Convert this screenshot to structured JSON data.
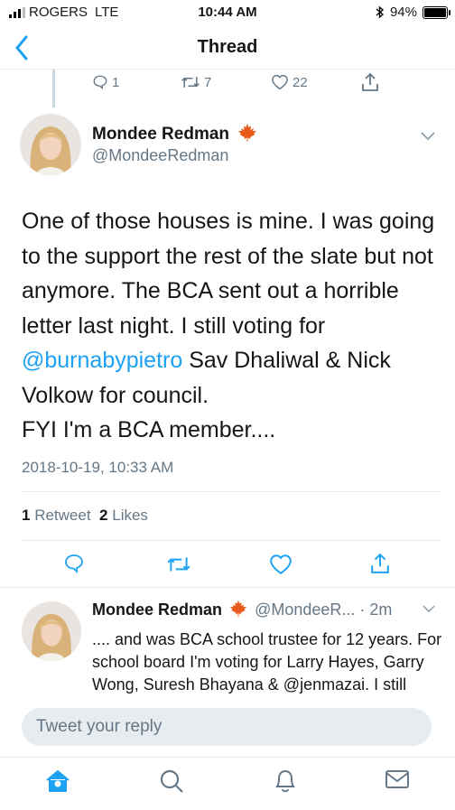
{
  "status_bar": {
    "carrier": "ROGERS",
    "network": "LTE",
    "time": "10:44 AM",
    "battery": "94%"
  },
  "nav": {
    "title": "Thread"
  },
  "prev_tweet_actions": {
    "replies": "1",
    "retweets": "7",
    "likes": "22"
  },
  "main_tweet": {
    "name": "Mondee Redman",
    "handle": "@MondeeRedman",
    "text_before_mention": "One of those houses is mine. I was going to the support the rest of the slate but not anymore. The BCA sent out a horrible letter last night.  I still voting for ",
    "mention": "@burnabypietro",
    "text_after_mention": " Sav Dhaliwal & Nick Volkow for council.",
    "text_line2": "FYI I'm a BCA member....",
    "timestamp": "2018-10-19, 10:33 AM",
    "retweet_count": "1",
    "retweet_label": "Retweet",
    "like_count": "2",
    "like_label": "Likes"
  },
  "reply_tweet": {
    "name": "Mondee Redman",
    "handle": "@MondeeR...",
    "time": "· 2m",
    "text": ".... and was BCA school trustee for 12 years. For school board I'm voting for Larry Hayes, Garry Wong, Suresh Bhayana & @jenmazai. I still thinking about what to do"
  },
  "compose": {
    "placeholder": "Tweet your reply"
  },
  "colors": {
    "accent": "#1da1f2",
    "muted": "#657786",
    "maple": "#e8591a"
  }
}
